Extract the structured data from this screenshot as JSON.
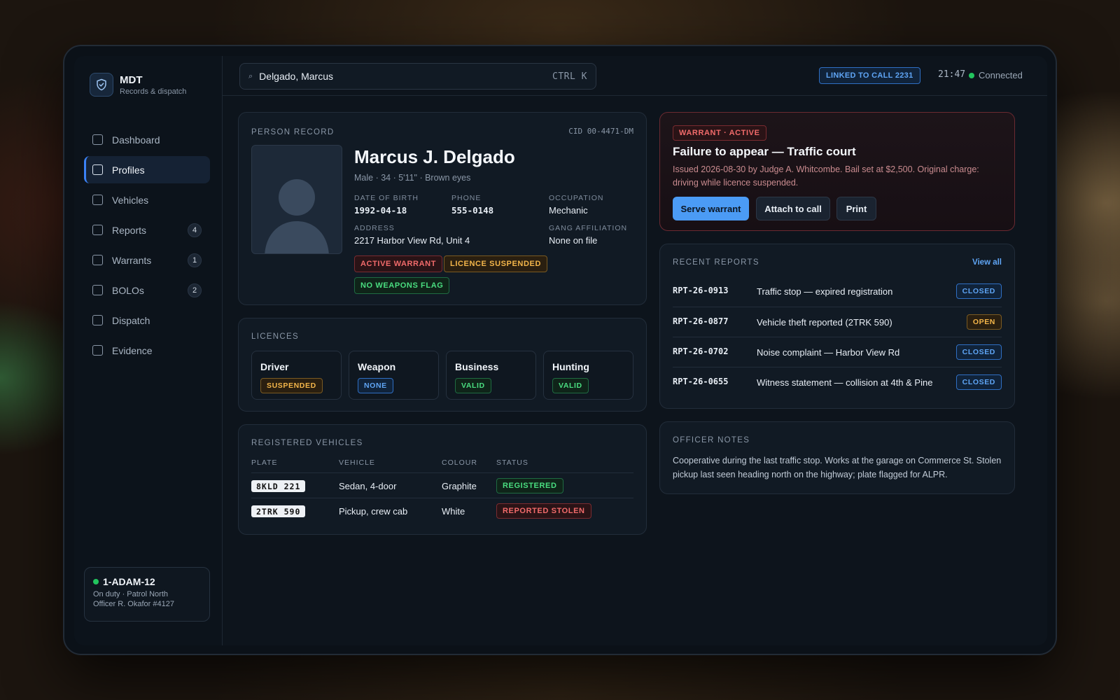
{
  "brand": {
    "title": "MDT",
    "subtitle": "Records & dispatch",
    "icon": "shield-check-icon"
  },
  "sidebar": {
    "items": [
      {
        "label": "Dashboard",
        "badge": null,
        "active": false
      },
      {
        "label": "Profiles",
        "badge": null,
        "active": true
      },
      {
        "label": "Vehicles",
        "badge": null,
        "active": false
      },
      {
        "label": "Reports",
        "badge": "4",
        "active": false
      },
      {
        "label": "Warrants",
        "badge": "1",
        "active": false
      },
      {
        "label": "BOLOs",
        "badge": "2",
        "active": false
      },
      {
        "label": "Dispatch",
        "badge": null,
        "active": false
      },
      {
        "label": "Evidence",
        "badge": null,
        "active": false
      }
    ],
    "unit": {
      "callsign": "1-ADAM-12",
      "status": "On duty · Patrol North",
      "officer": "Officer R. Okafor #4127"
    }
  },
  "topbar": {
    "search_value": "Delgado, Marcus",
    "search_shortcut": "CTRL K",
    "linked": "LINKED TO CALL 2231",
    "time": "21:47",
    "connection": "Connected"
  },
  "person": {
    "section": "PERSON RECORD",
    "cid": "CID 00-4471-DM",
    "name": "Marcus J. Delgado",
    "summary": "Male · 34 · 5'11\" · Brown eyes",
    "dob_label": "DATE OF BIRTH",
    "dob": "1992-04-18",
    "phone_label": "PHONE",
    "phone": "555-0148",
    "occupation_label": "OCCUPATION",
    "occupation": "Mechanic",
    "address_label": "ADDRESS",
    "address": "2217 Harbor View Rd, Unit 4",
    "gang_label": "GANG AFFILIATION",
    "gang": "None on file",
    "flags": [
      "ACTIVE WARRANT",
      "LICENCE SUSPENDED",
      "NO WEAPONS FLAG"
    ]
  },
  "licences": {
    "section": "LICENCES",
    "items": [
      {
        "name": "Driver",
        "status": "SUSPENDED"
      },
      {
        "name": "Weapon",
        "status": "NONE"
      },
      {
        "name": "Business",
        "status": "VALID"
      },
      {
        "name": "Hunting",
        "status": "VALID"
      }
    ]
  },
  "vehicles": {
    "section": "REGISTERED VEHICLES",
    "columns": [
      "PLATE",
      "VEHICLE",
      "COLOUR",
      "STATUS"
    ],
    "rows": [
      {
        "plate": "8KLD 221",
        "vehicle": "Sedan, 4-door",
        "colour": "Graphite",
        "status": "REGISTERED"
      },
      {
        "plate": "2TRK 590",
        "vehicle": "Pickup, crew cab",
        "colour": "White",
        "status": "REPORTED STOLEN"
      }
    ]
  },
  "warrant": {
    "tag": "WARRANT · ACTIVE",
    "title": "Failure to appear — Traffic court",
    "description": "Issued 2026-08-30 by Judge A. Whitcombe. Bail set at $2,500. Original charge: driving while licence suspended.",
    "serve": "Serve warrant",
    "attach": "Attach to call",
    "print": "Print"
  },
  "reports": {
    "section": "RECENT REPORTS",
    "view_all": "View all",
    "rows": [
      {
        "id": "RPT-26-0913",
        "title": "Traffic stop — expired registration",
        "status": "CLOSED"
      },
      {
        "id": "RPT-26-0877",
        "title": "Vehicle theft reported (2TRK 590)",
        "status": "OPEN"
      },
      {
        "id": "RPT-26-0702",
        "title": "Noise complaint — Harbor View Rd",
        "status": "CLOSED"
      },
      {
        "id": "RPT-26-0655",
        "title": "Witness statement — collision at 4th & Pine",
        "status": "CLOSED"
      }
    ]
  },
  "notes": {
    "section": "OFFICER NOTES",
    "text": "Cooperative during the last traffic stop. Works at the garage on Commerce St. Stolen pickup last seen heading north on the highway; plate flagged for ALPR."
  },
  "colors": {
    "accent": "#4b9bf5",
    "danger": "#f26b6b",
    "warning": "#f4b64a",
    "success": "#4ade80",
    "online": "#22c55e"
  }
}
